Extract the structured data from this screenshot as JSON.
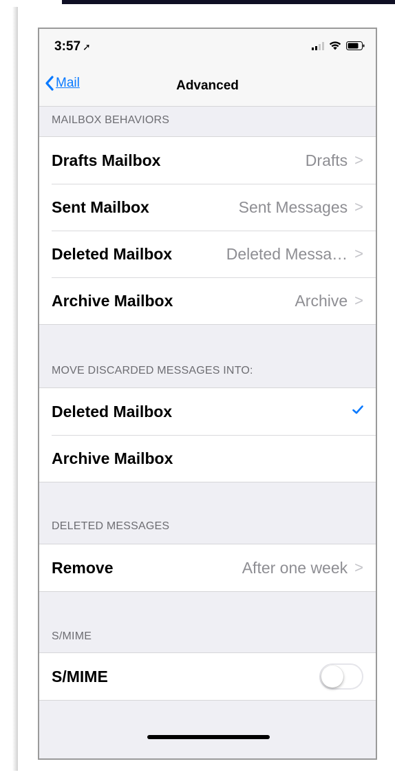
{
  "status_bar": {
    "time": "3:57",
    "location_icon": "location-arrow-icon",
    "signal_icon": "cellular-signal-icon",
    "wifi_icon": "wifi-icon",
    "battery_icon": "battery-icon"
  },
  "nav": {
    "back_label": "Mail",
    "back_icon": "chevron-left-icon",
    "title": "Advanced"
  },
  "sections": {
    "mailbox_behaviors": {
      "header": "MAILBOX BEHAVIORS",
      "rows": [
        {
          "label": "Drafts Mailbox",
          "value": "Drafts"
        },
        {
          "label": "Sent Mailbox",
          "value": "Sent Messages"
        },
        {
          "label": "Deleted Mailbox",
          "value": "Deleted Messa…"
        },
        {
          "label": "Archive Mailbox",
          "value": "Archive"
        }
      ]
    },
    "move_discarded": {
      "header": "MOVE DISCARDED MESSAGES INTO:",
      "rows": [
        {
          "label": "Deleted Mailbox",
          "checked": true
        },
        {
          "label": "Archive Mailbox",
          "checked": false
        }
      ]
    },
    "deleted_messages": {
      "header": "DELETED MESSAGES",
      "rows": [
        {
          "label": "Remove",
          "value": "After one week"
        }
      ]
    },
    "smime": {
      "header": "S/MIME",
      "rows": [
        {
          "label": "S/MIME",
          "toggle_on": false
        }
      ]
    }
  },
  "colors": {
    "accent": "#0a7aff",
    "background": "#efeff4",
    "secondary_text": "#8e8e93",
    "header_text": "#6d6d72"
  }
}
